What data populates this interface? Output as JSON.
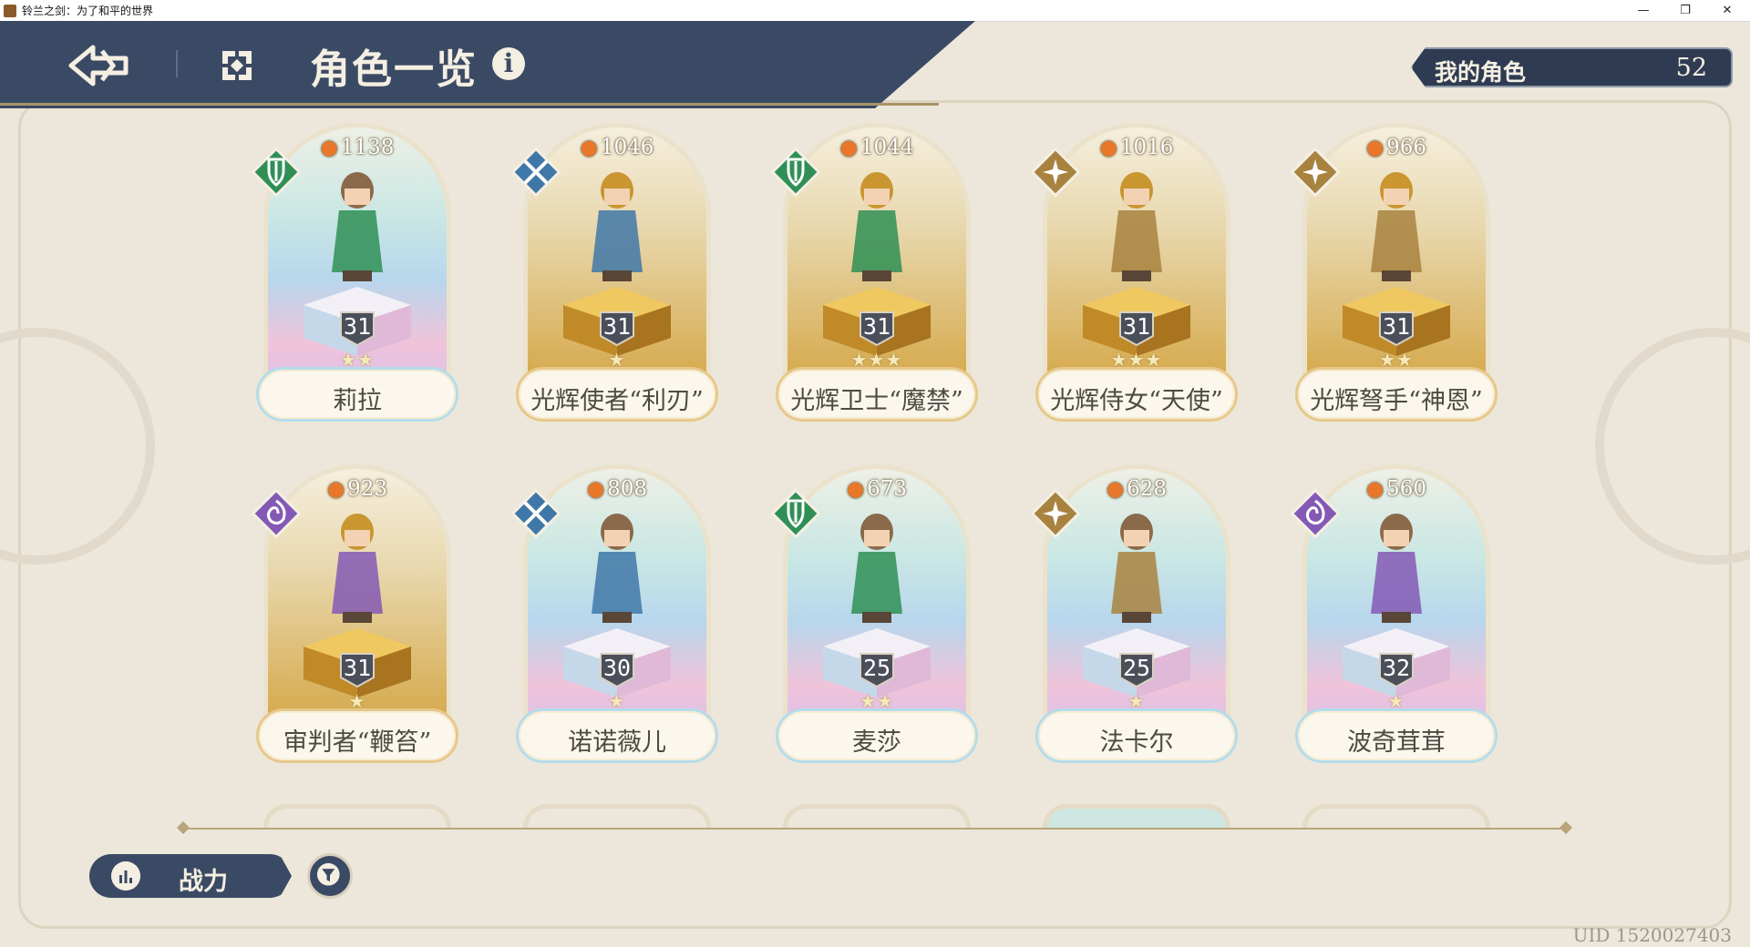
{
  "window": {
    "title": "铃兰之剑：为了和平的世界",
    "controls": {
      "minimize": "—",
      "restore": "❐",
      "close": "✕"
    }
  },
  "header": {
    "title": "角色一览",
    "info_icon": "i",
    "my_characters_label": "我的角色",
    "my_characters_count": "52"
  },
  "colors": {
    "header_bg": "#3b4a64",
    "paper_bg": "#ece7da",
    "flame": "#e9772a",
    "class_green": "#2f8f55",
    "class_blue": "#3f78a8",
    "class_gold": "#a8823f",
    "class_purple": "#8459b5"
  },
  "characters": [
    {
      "name": "莉拉",
      "power": "1138",
      "level": "31",
      "stars": "★★",
      "class_icon": "shield-class-icon",
      "class_color": "green",
      "bg": "irid"
    },
    {
      "name": "光辉使者“利刃”",
      "power": "1046",
      "level": "31",
      "stars": "★",
      "class_icon": "crossed-swords-class-icon",
      "class_color": "blue",
      "bg": "gold"
    },
    {
      "name": "光辉卫士“魔禁”",
      "power": "1044",
      "level": "31",
      "stars": "★★★",
      "class_icon": "shield-class-icon",
      "class_color": "green",
      "bg": "gold"
    },
    {
      "name": "光辉侍女“天使”",
      "power": "1016",
      "level": "31",
      "stars": "★★★",
      "class_icon": "star-class-icon",
      "class_color": "gold",
      "bg": "gold"
    },
    {
      "name": "光辉弩手“神恩”",
      "power": "966",
      "level": "31",
      "stars": "★★",
      "class_icon": "star-class-icon",
      "class_color": "gold",
      "bg": "gold"
    },
    {
      "name": "审判者“鞭笞”",
      "power": "923",
      "level": "31",
      "stars": "★",
      "class_icon": "magic-class-icon",
      "class_color": "purple",
      "bg": "gold"
    },
    {
      "name": "诺诺薇儿",
      "power": "808",
      "level": "30",
      "stars": "★",
      "class_icon": "crossed-swords-class-icon",
      "class_color": "blue",
      "bg": "irid"
    },
    {
      "name": "麦莎",
      "power": "673",
      "level": "25",
      "stars": "★★",
      "class_icon": "shield-class-icon",
      "class_color": "green",
      "bg": "irid"
    },
    {
      "name": "法卡尔",
      "power": "628",
      "level": "25",
      "stars": "★",
      "class_icon": "star-class-icon",
      "class_color": "gold",
      "bg": "irid"
    },
    {
      "name": "波奇茸茸",
      "power": "560",
      "level": "32",
      "stars": "★",
      "class_icon": "magic-class-icon",
      "class_color": "purple",
      "bg": "irid"
    }
  ],
  "bottom": {
    "sort_label": "战力",
    "uid_text": "UID 1520027403"
  }
}
